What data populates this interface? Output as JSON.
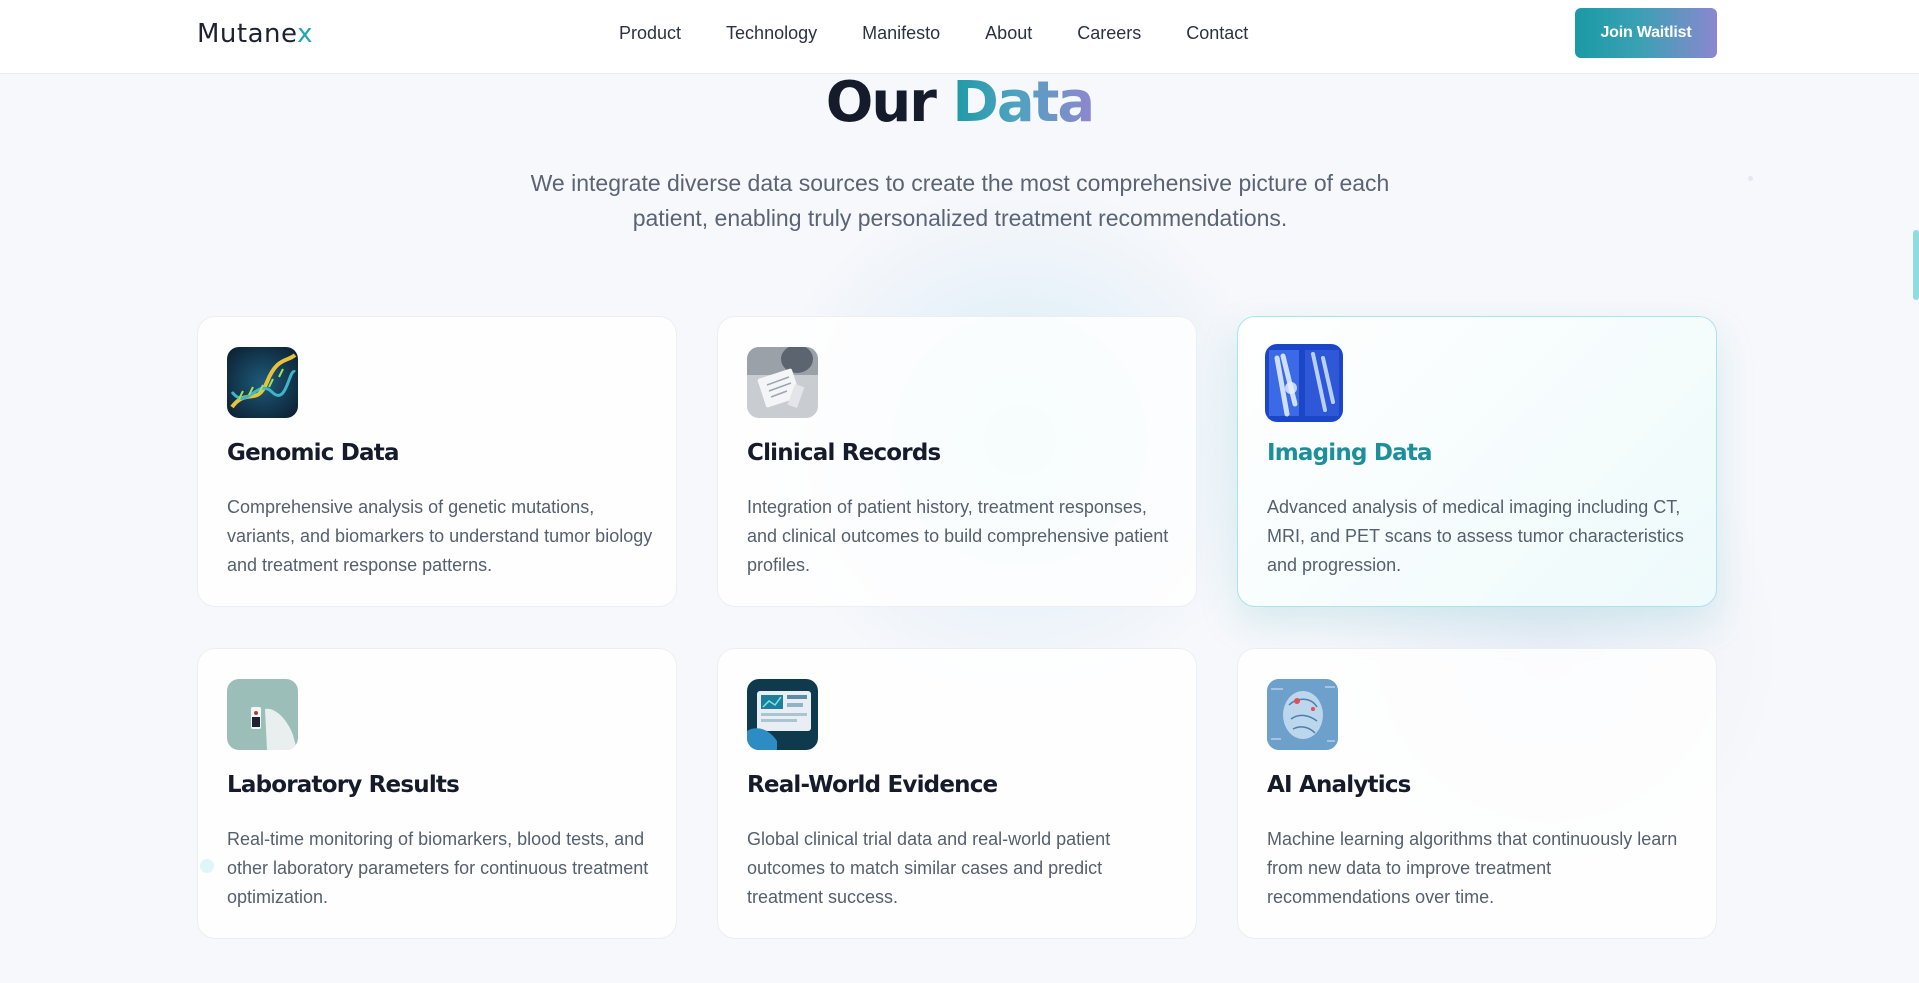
{
  "header": {
    "logo_main": "Mutane",
    "logo_accent": "x",
    "nav": [
      "Product",
      "Technology",
      "Manifesto",
      "About",
      "Careers",
      "Contact"
    ],
    "cta_label": "Join Waitlist"
  },
  "section": {
    "title_plain": "Our",
    "title_accent": "Data",
    "subtitle": "We integrate diverse data sources to create the most comprehensive picture of each patient, enabling truly personalized treatment recommendations."
  },
  "cards": [
    {
      "title": "Genomic Data",
      "description": "Comprehensive analysis of genetic mutations, variants, and biomarkers to understand tumor biology and treatment response patterns.",
      "icon": "dna-helix-image"
    },
    {
      "title": "Clinical Records",
      "description": "Integration of patient history, treatment responses, and clinical outcomes to build comprehensive patient profiles.",
      "icon": "clinical-document-image"
    },
    {
      "title": "Imaging Data",
      "description": "Advanced analysis of medical imaging including CT, MRI, and PET scans to assess tumor characteristics and progression.",
      "icon": "xray-scan-image",
      "active": true
    },
    {
      "title": "Laboratory Results",
      "description": "Real-time monitoring of biomarkers, blood tests, and other laboratory parameters for continuous treatment optimization.",
      "icon": "lab-sample-image"
    },
    {
      "title": "Real-World Evidence",
      "description": "Global clinical trial data and real-world patient outcomes to match similar cases and predict treatment success.",
      "icon": "data-tablet-image"
    },
    {
      "title": "AI Analytics",
      "description": "Machine learning algorithms that continuously learn from new data to improve treatment recommendations over time.",
      "icon": "ai-head-image"
    }
  ],
  "colors": {
    "accent_teal": "#1a9aa5",
    "accent_purple": "#8b87cf",
    "active_title": "#1b8f9c"
  }
}
